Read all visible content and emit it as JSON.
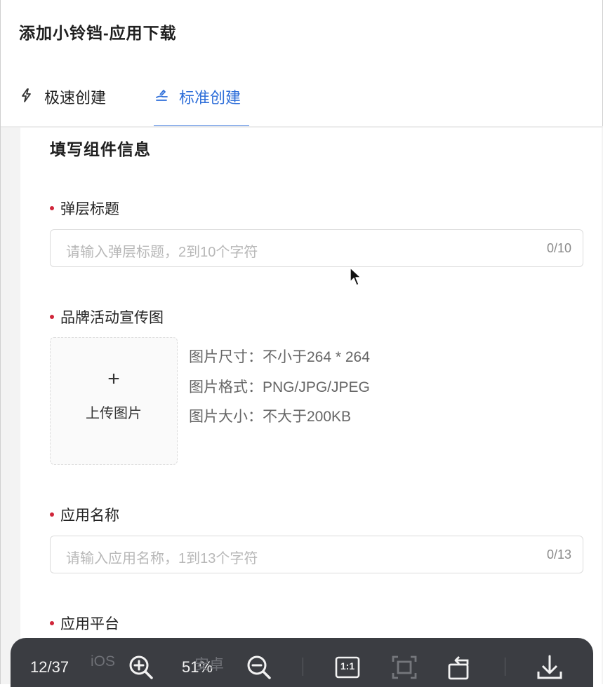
{
  "header": {
    "title": "添加小铃铛-应用下载"
  },
  "tabs": [
    {
      "label": "极速创建",
      "icon": "lightning-icon",
      "active": false
    },
    {
      "label": "标准创建",
      "icon": "hand-edit-icon",
      "active": true
    }
  ],
  "form": {
    "section_title": "填写组件信息",
    "popup_title": {
      "label": "弹层标题",
      "placeholder": "请输入弹层标题，2到10个字符",
      "counter": "0/10"
    },
    "brand_image": {
      "label": "品牌活动宣传图",
      "upload_plus": "+",
      "upload_label": "上传图片",
      "specs": [
        "图片尺寸：不小于264 * 264",
        "图片格式：PNG/JPG/JPEG",
        "图片大小：不大于200KB"
      ]
    },
    "app_name": {
      "label": "应用名称",
      "placeholder": "请输入应用名称，1到13个字符",
      "counter": "0/13"
    },
    "app_platform": {
      "label": "应用平台",
      "options": [
        "iOS",
        "安卓"
      ]
    }
  },
  "viewer_toolbar": {
    "page": "12/37",
    "zoom": "51%",
    "actual_size_label": "1:1",
    "icons": [
      "zoom-in-icon",
      "zoom-out-icon",
      "actual-size-icon",
      "fit-screen-icon",
      "rotate-icon",
      "download-icon"
    ]
  },
  "colors": {
    "accent": "#2f6fd9",
    "required": "#d0263a",
    "toolbar_bg": "#3b3d42"
  }
}
